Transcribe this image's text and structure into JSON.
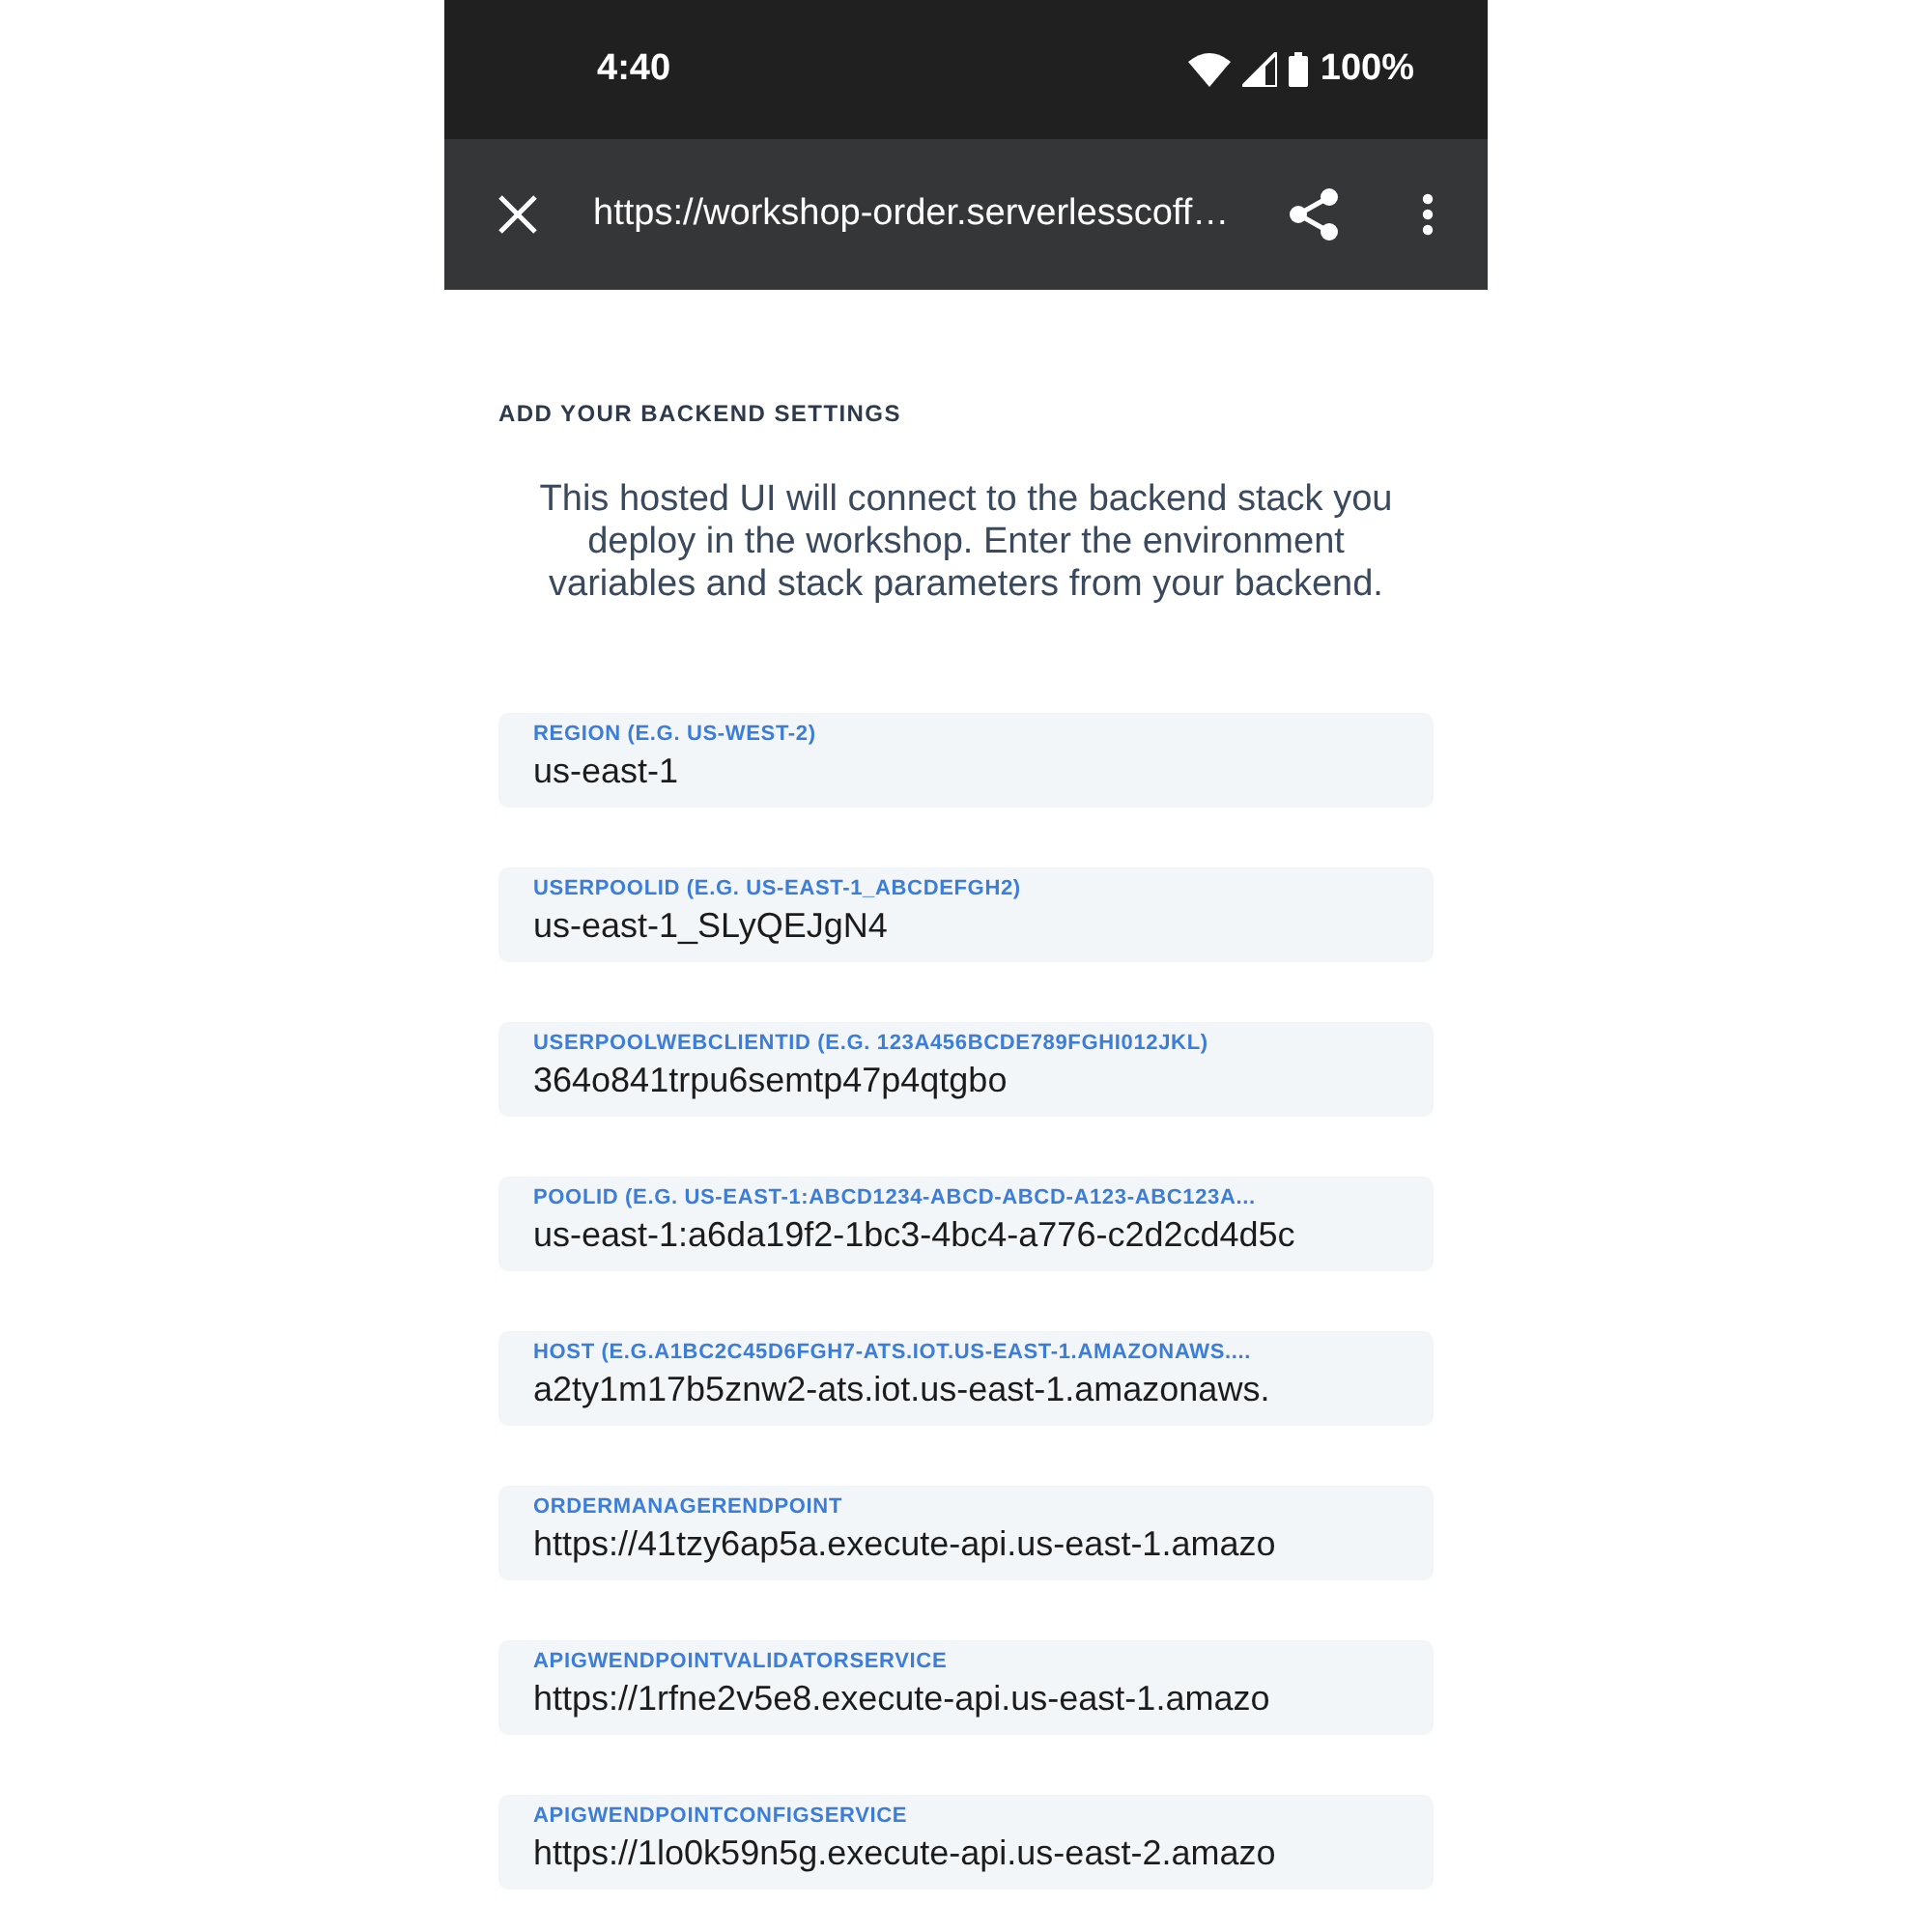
{
  "status_bar": {
    "time": "4:40",
    "battery": "100%"
  },
  "toolbar": {
    "url": "https://workshop-order.serverlesscoff…"
  },
  "heading": "ADD YOUR BACKEND SETTINGS",
  "intro": "This hosted UI will connect to the backend stack you deploy in the workshop. Enter the environment variables and stack parameters from your backend.",
  "fields": [
    {
      "label": "REGION (E.G. US-WEST-2)",
      "value": "us-east-1"
    },
    {
      "label": "USERPOOLID (E.G. US-EAST-1_ABCDEFGH2)",
      "value": "us-east-1_SLyQEJgN4"
    },
    {
      "label": "USERPOOLWEBCLIENTID (E.G. 123A456BCDE789FGHI012JKL)",
      "value": "364o841trpu6semtp47p4qtgbo"
    },
    {
      "label": "POOLID (E.G. US-EAST-1:ABCD1234-ABCD-ABCD-A123-ABC123A...",
      "value": "us-east-1:a6da19f2-1bc3-4bc4-a776-c2d2cd4d5c"
    },
    {
      "label": "HOST (E.G.A1BC2C45D6FGH7-ATS.IOT.US-EAST-1.AMAZONAWS....",
      "value": "a2ty1m17b5znw2-ats.iot.us-east-1.amazonaws."
    },
    {
      "label": "ORDERMANAGERENDPOINT",
      "value": "https://41tzy6ap5a.execute-api.us-east-1.amazo"
    },
    {
      "label": "APIGWENDPOINTVALIDATORSERVICE",
      "value": "https://1rfne2v5e8.execute-api.us-east-1.amazo"
    },
    {
      "label": "APIGWENDPOINTCONFIGSERVICE",
      "value": "https://1lo0k59n5g.execute-api.us-east-2.amazo"
    }
  ]
}
